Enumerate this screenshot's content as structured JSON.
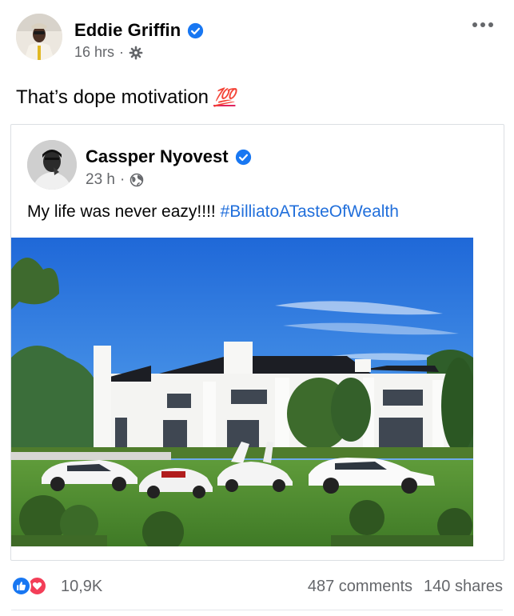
{
  "post": {
    "author": "Eddie Griffin",
    "time": "16 hrs",
    "separator": "·",
    "caption": "That’s dope motivation",
    "caption_emoji": "💯",
    "audience_icon": "gear-icon"
  },
  "shared_post": {
    "author": "Cassper Nyovest",
    "time": "23 h",
    "separator": "·",
    "text": "My life was never eazy!!!! ",
    "hashtag": "#BilliatoATasteOfWealth",
    "audience_icon": "globe-icon",
    "photo_subject": "white mansion with luxury cars on a lawn"
  },
  "footer": {
    "reaction_count": "10,9K",
    "comments": "487 comments",
    "shares": "140 shares"
  },
  "colors": {
    "verified": "#1877f2",
    "hashtag": "#216fdb",
    "secondary_text": "#65676b",
    "like": "#1877f2",
    "love": "#f33e58"
  }
}
